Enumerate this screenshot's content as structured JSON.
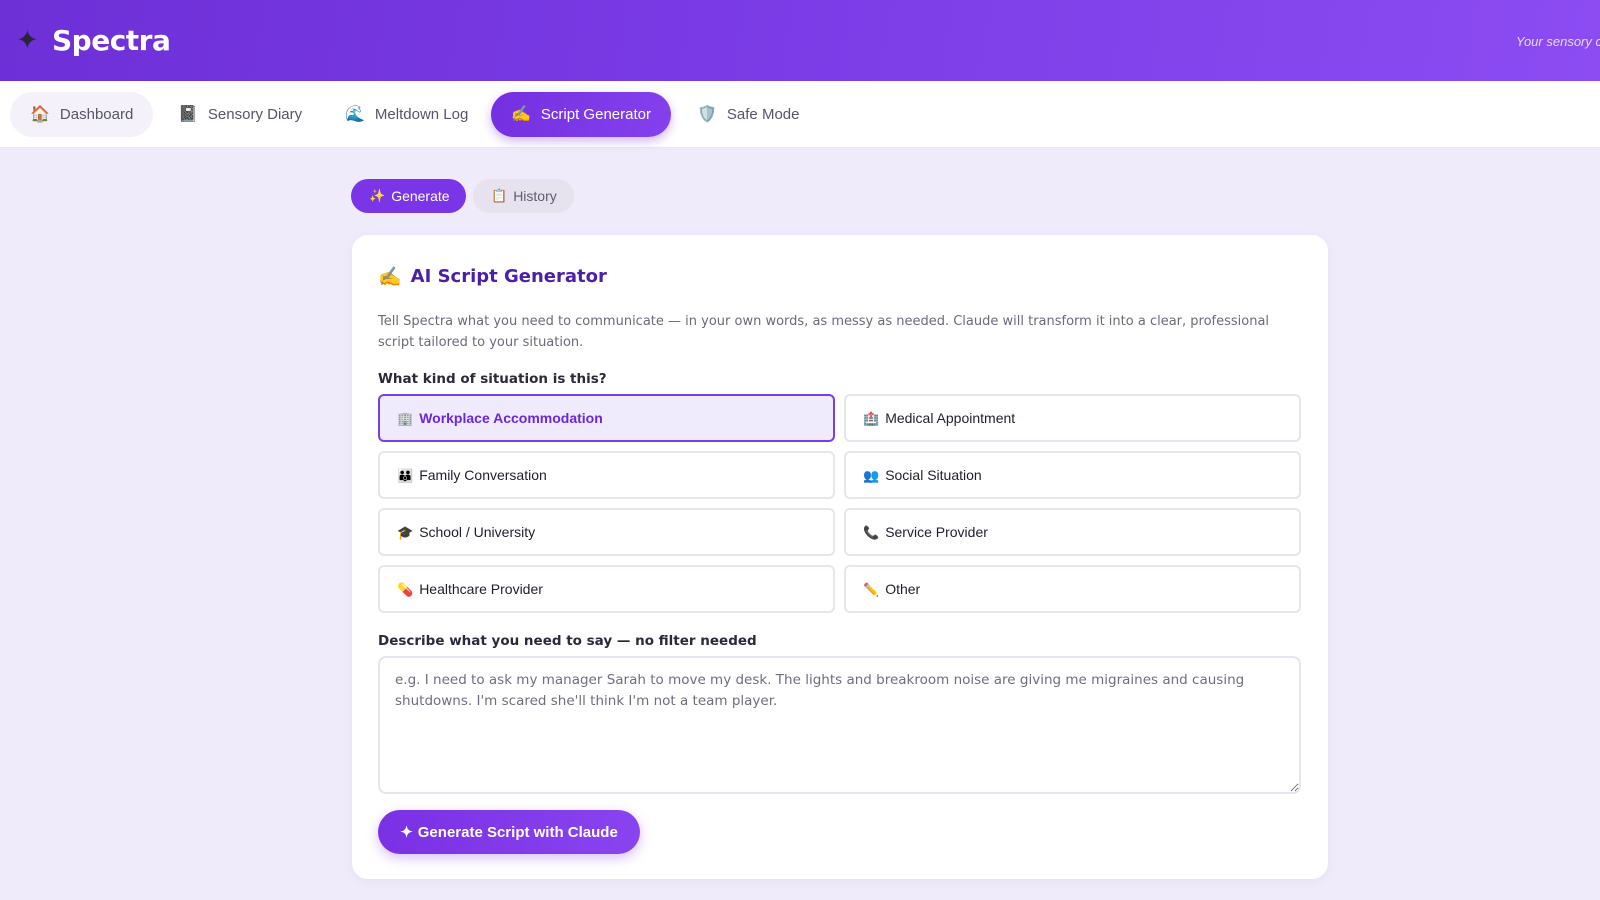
{
  "header": {
    "logo_icon": "✦",
    "app_name": "Spectra",
    "tagline": "Your sensory c"
  },
  "nav": {
    "items": [
      {
        "icon": "🏠",
        "label": "Dashboard"
      },
      {
        "icon": "📓",
        "label": "Sensory Diary"
      },
      {
        "icon": "🌊",
        "label": "Meltdown Log"
      },
      {
        "icon": "✍️",
        "label": "Script Generator",
        "active": true
      },
      {
        "icon": "🛡️",
        "label": "Safe Mode"
      }
    ]
  },
  "subtabs": {
    "generate": {
      "icon": "✨",
      "label": "Generate"
    },
    "history": {
      "icon": "📋",
      "label": "History"
    }
  },
  "card": {
    "title_icon": "✍️",
    "title": "AI Script Generator",
    "description": "Tell Spectra what you need to communicate — in your own words, as messy as needed. Claude will transform it into a clear, professional script tailored to your situation.",
    "situation_label": "What kind of situation is this?",
    "situations": [
      {
        "icon": "🏢",
        "label": "Workplace Accommodation",
        "selected": true
      },
      {
        "icon": "🏥",
        "label": "Medical Appointment"
      },
      {
        "icon": "👪",
        "label": "Family Conversation"
      },
      {
        "icon": "👥",
        "label": "Social Situation"
      },
      {
        "icon": "🎓",
        "label": "School / University"
      },
      {
        "icon": "📞",
        "label": "Service Provider"
      },
      {
        "icon": "💊",
        "label": "Healthcare Provider"
      },
      {
        "icon": "✏️",
        "label": "Other"
      }
    ],
    "describe_label": "Describe what you need to say — no filter needed",
    "textarea_placeholder": "e.g. I need to ask my manager Sarah to move my desk. The lights and breakroom noise are giving me migraines and causing shutdowns. I'm scared she'll think I'm not a team player.",
    "generate_button": {
      "icon": "✦",
      "label": "Generate Script with Claude"
    }
  },
  "colors": {
    "accent": "#7a35e6",
    "title": "#4c1fa8",
    "background": "#efebfb"
  }
}
